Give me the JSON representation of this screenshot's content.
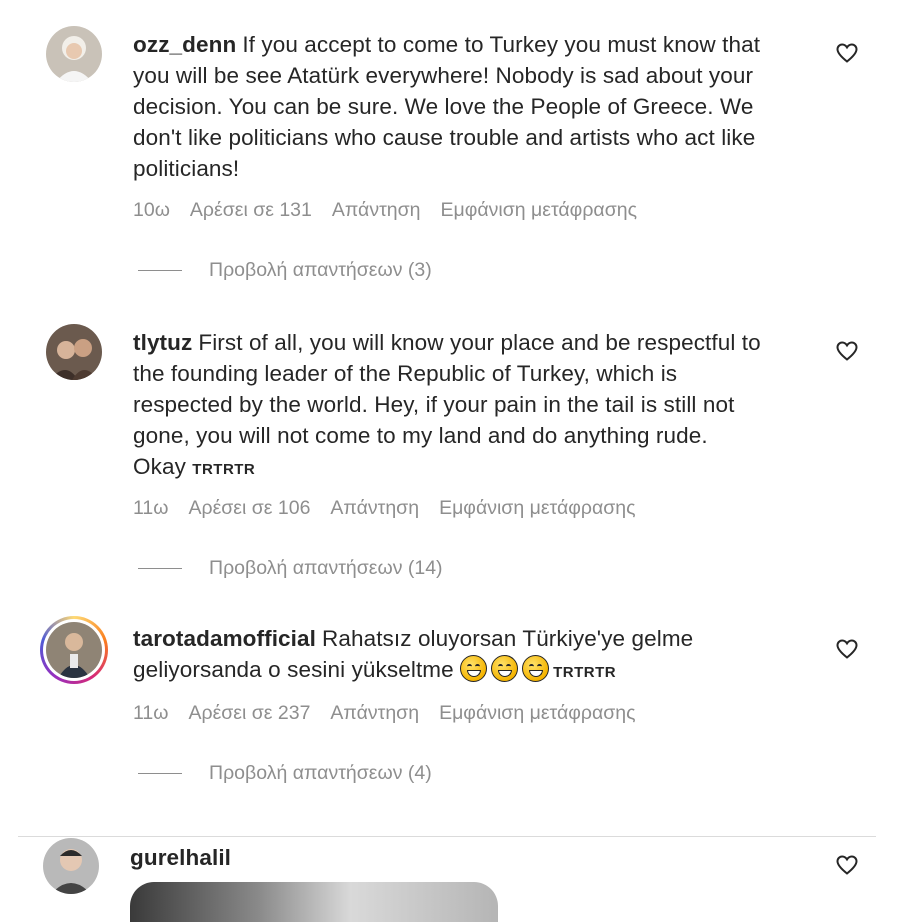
{
  "comments": [
    {
      "username": "ozz_denn",
      "lines": [
        "If you accept to come to Turkey you must know that",
        "you will be see Atatürk everywhere! Nobody is sad about your",
        "decision. You can be sure. We love the People of Greece. We",
        "don't like politicians who cause trouble and artists who act like",
        "politicians!"
      ],
      "time": "10ω",
      "likes": "Αρέσει σε 131",
      "reply": "Απάντηση",
      "translate": "Εμφάνιση μετάφρασης",
      "view_replies": "Προβολή απαντήσεων (3)",
      "avatar_icon": "user-avatar-photo"
    },
    {
      "username": "tlytuz",
      "lines": [
        "First of all, you will know your place and be respectful to",
        "the founding leader of the Republic of Turkey, which is",
        "respected by the world. Hey, if your pain in the tail is still not",
        "gone, you will not come to my land and do anything rude.",
        "Okay"
      ],
      "tag": "TRTRTR",
      "time": "11ω",
      "likes": "Αρέσει σε 106",
      "reply": "Απάντηση",
      "translate": "Εμφάνιση μετάφρασης",
      "view_replies": "Προβολή απαντήσεων (14)",
      "avatar_icon": "user-avatar-photo"
    },
    {
      "username": "tarotadamofficial",
      "lines": [
        "Rahatsız oluyorsan Türkiye'ye gelme",
        "geliyorsanda o sesini yükseltme"
      ],
      "emojis": [
        "laughing-tears-emoji",
        "grinning-sweat-emoji",
        "rolling-laughing-emoji"
      ],
      "tag": "TRTRTR",
      "time": "11ω",
      "likes": "Αρέσει σε 237",
      "reply": "Απάντηση",
      "translate": "Εμφάνιση μετάφρασης",
      "view_replies": "Προβολή απαντήσεων (4)",
      "avatar_icon": "user-avatar-photo-story-ring"
    },
    {
      "username": "gurelhalil",
      "avatar_icon": "user-avatar-photo"
    }
  ],
  "colors": {
    "text": "#262626",
    "secondary": "#8e8e8e",
    "divider": "#dbdbdb"
  },
  "icons": {
    "like": "heart-outline-icon"
  }
}
